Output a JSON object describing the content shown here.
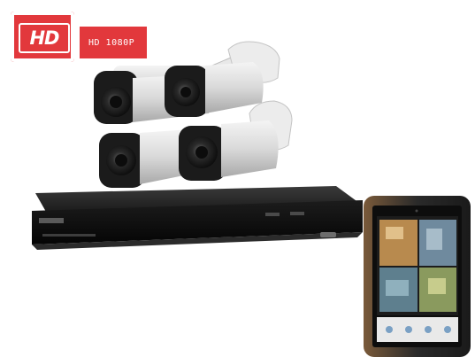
{
  "badge": {
    "hd_text": "HD",
    "resolution_text": "HD 1080P",
    "accent_color": "#e2383c"
  },
  "products": {
    "cameras": [
      "bullet-camera",
      "bullet-camera",
      "bullet-camera",
      "bullet-camera"
    ],
    "recorder": "dvr-recorder",
    "tablet": "tablet-with-video-feeds"
  }
}
